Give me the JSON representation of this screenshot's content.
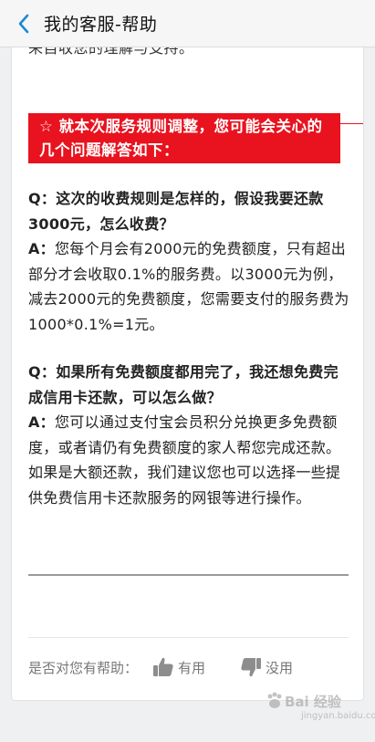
{
  "header": {
    "title": "我的客服-帮助"
  },
  "article": {
    "cut_text": "来自收您的理解与支持。",
    "notice": "☆ 就本次服务规则调整，您可能会关心的几个问题解答如下：",
    "qa": [
      {
        "q_prefix": "Q：",
        "q_text": "这次的收费规则是怎样的，假设我要还款3000元，怎么收费？",
        "a_prefix": "A：",
        "a_text": "您每个月会有2000元的免费额度，只有超出部分才会收取0.1%的服务费。以3000元为例，减去2000元的免费额度，您需要支付的服务费为1000*0.1%=1元。"
      },
      {
        "q_prefix": "Q：",
        "q_text": "如果所有免费额度都用完了，我还想免费完成信用卡还款，可以怎么做？",
        "a_prefix": "A：",
        "a_text": "您可以通过支付宝会员积分兑换更多免费额度，或者请仍有免费额度的家人帮您完成还款。如果是大额还款，我们建议您也可以选择一些提供免费信用卡还款服务的网银等进行操作。"
      }
    ]
  },
  "feedback": {
    "prompt": "是否对您有帮助：",
    "useful": "有用",
    "useless": "没用"
  },
  "watermark": {
    "brand": "Bai 经验",
    "domain": "jingyan.baidu.com"
  }
}
